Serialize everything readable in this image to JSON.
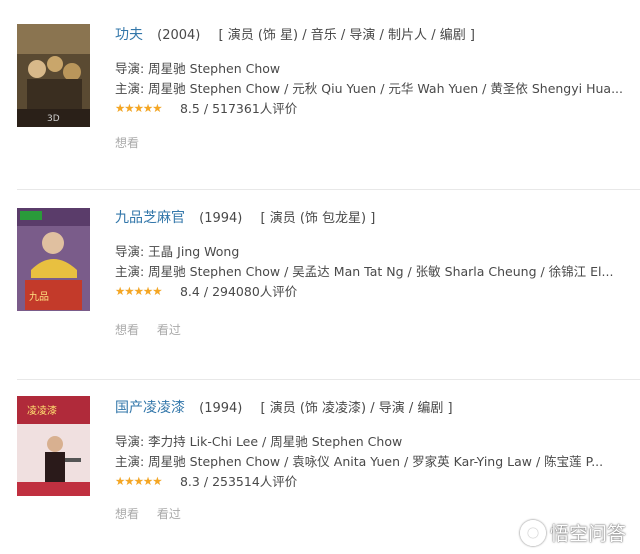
{
  "items": [
    {
      "title": "功夫",
      "year": "(2004)",
      "roles": "[ 演员 (饰 星) / 音乐 / 导演 / 制片人 / 编剧 ]",
      "director": "导演: 周星驰 Stephen Chow",
      "cast": "主演: 周星驰 Stephen Chow / 元秋 Qiu Yuen / 元华 Wah Yuen / 黄圣依 Shengyi Hua...",
      "rating_stars": 4.5,
      "score": "8.5",
      "sep": "/",
      "votes": "517361人评价",
      "actions": [
        "想看"
      ],
      "poster_colors": [
        "#6b5a3e",
        "#c9a66b",
        "#3a2e20"
      ]
    },
    {
      "title": "九品芝麻官",
      "year": "(1994)",
      "roles": "[ 演员 (饰 包龙星) ]",
      "director": "导演: 王晶 Jing Wong",
      "cast": "主演: 周星驰 Stephen Chow / 吴孟达 Man Tat Ng / 张敏 Sharla Cheung / 徐锦江 El...",
      "rating_stars": 4.5,
      "score": "8.4",
      "sep": "/",
      "votes": "294080人评价",
      "actions": [
        "想看",
        "看过"
      ],
      "poster_colors": [
        "#7a5c8a",
        "#e8c040",
        "#c33a2a"
      ]
    },
    {
      "title": "国产凌凌漆",
      "year": "(1994)",
      "roles": "[ 演员 (饰 凌凌漆) / 导演 / 编剧 ]",
      "director": "导演: 李力持 Lik-Chi Lee / 周星驰 Stephen Chow",
      "cast": "主演: 周星驰 Stephen Chow / 袁咏仪 Anita Yuen / 罗家英 Kar-Ying Law / 陈宝莲 P...",
      "rating_stars": 4.5,
      "score": "8.3",
      "sep": "/",
      "votes": "253514人评价",
      "actions": [
        "想看",
        "看过"
      ],
      "poster_colors": [
        "#b02a3a",
        "#f0e0e0",
        "#2a1a1a"
      ]
    }
  ],
  "star_glyphs": "★★★★★",
  "watermark": "悟空问答",
  "colors": {
    "link": "#3377aa",
    "star": "#f5a623",
    "muted": "#aaaaaa"
  }
}
